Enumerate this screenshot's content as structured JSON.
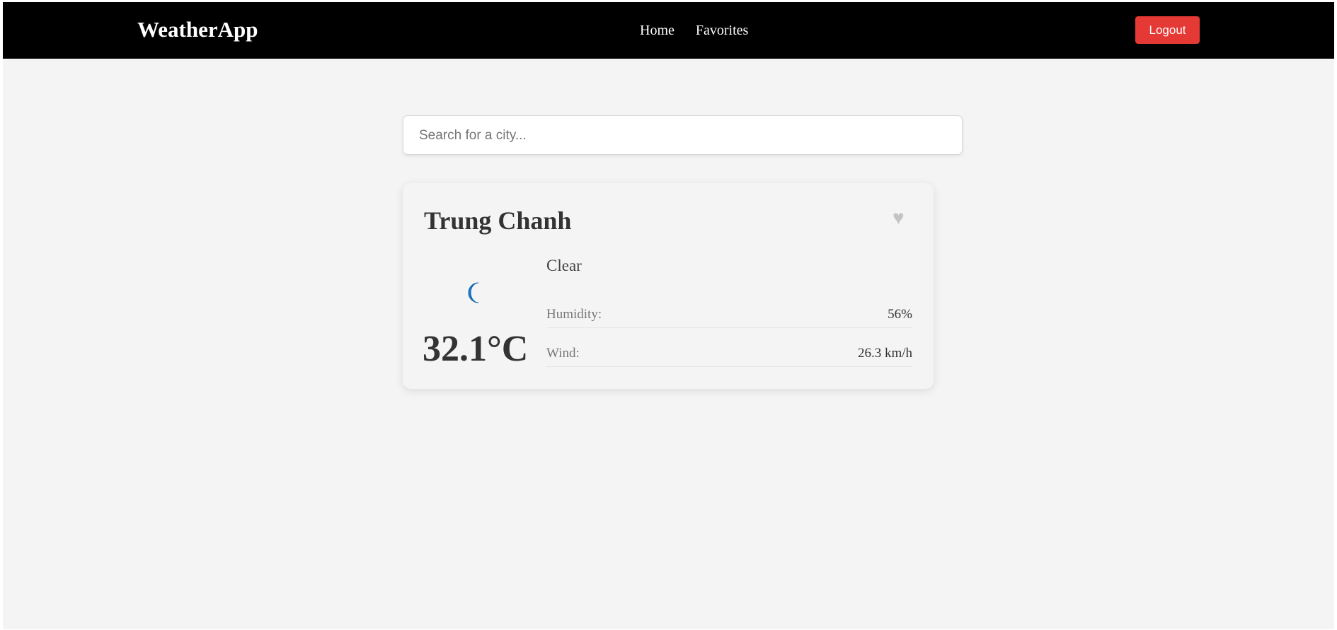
{
  "navbar": {
    "brand": "WeatherApp",
    "links": [
      {
        "label": "Home"
      },
      {
        "label": "Favorites"
      }
    ],
    "logout_label": "Logout"
  },
  "search": {
    "placeholder": "Search for a city...",
    "value": ""
  },
  "weather": {
    "city": "Trung Chanh",
    "favorite_icon": "heart-icon",
    "favorite_symbol": "♥",
    "condition": "Clear",
    "condition_icon": "moon-icon",
    "temperature": "32.1°C",
    "details": {
      "humidity": {
        "label": "Humidity:",
        "value": "56%"
      },
      "wind": {
        "label": "Wind:",
        "value": "26.3 km/h"
      }
    }
  },
  "colors": {
    "navbar_bg": "#000000",
    "logout_bg": "#e53935",
    "page_bg": "#f4f4f4",
    "moon_icon": "#1e7bd0",
    "favorite_inactive": "#c4c4c4"
  }
}
